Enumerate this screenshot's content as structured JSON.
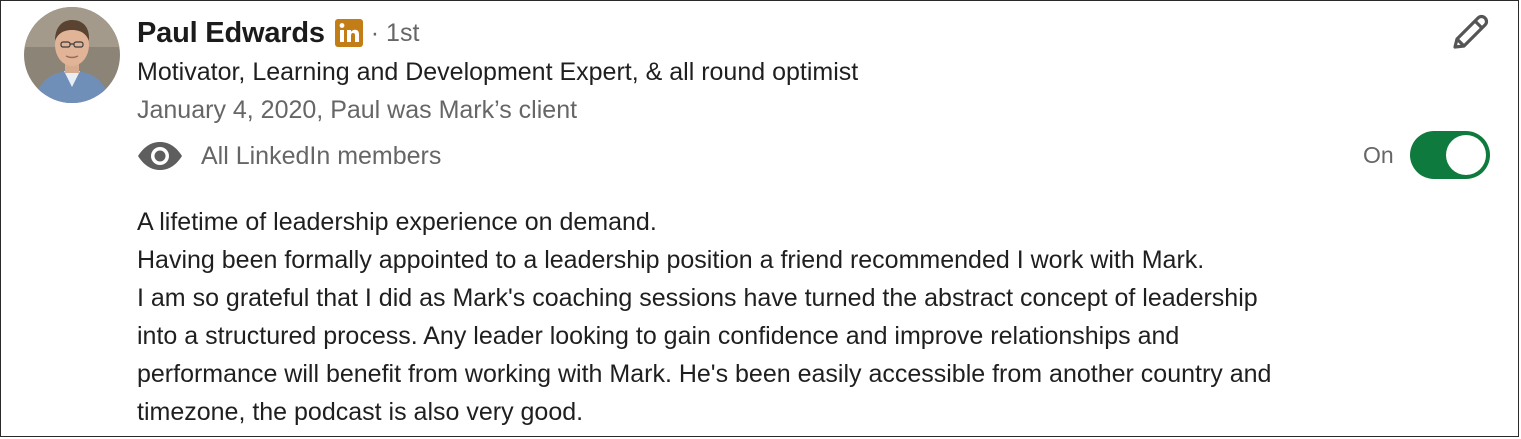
{
  "recommendation": {
    "author_name": "Paul Edwards",
    "linkedin_badge_icon": "linkedin-icon",
    "connection_degree": "· 1st",
    "headline": "Motivator, Learning and Development Expert, & all round optimist",
    "relationship_line": "January 4, 2020, Paul was Mark’s client",
    "visibility": {
      "icon": "eye-icon",
      "label": "All LinkedIn members"
    },
    "edit_icon": "pencil-icon",
    "toggle": {
      "label": "On",
      "state": "on"
    },
    "body_lines": [
      "A lifetime of leadership experience on demand.",
      "Having been formally appointed to a leadership position a friend recommended I work with Mark.",
      "I am so grateful that I did as Mark's coaching sessions have turned the abstract concept of leadership",
      "into a structured process. Any leader looking to gain confidence and improve relationships and",
      "performance will benefit from working with Mark. He's been easily accessible from another country and",
      "timezone, the podcast is also very good."
    ]
  },
  "colors": {
    "toggle_on": "#0f7a3d",
    "linkedin_badge": "#c37d16",
    "muted_text": "#666666",
    "primary_text": "#1f1f1f"
  }
}
